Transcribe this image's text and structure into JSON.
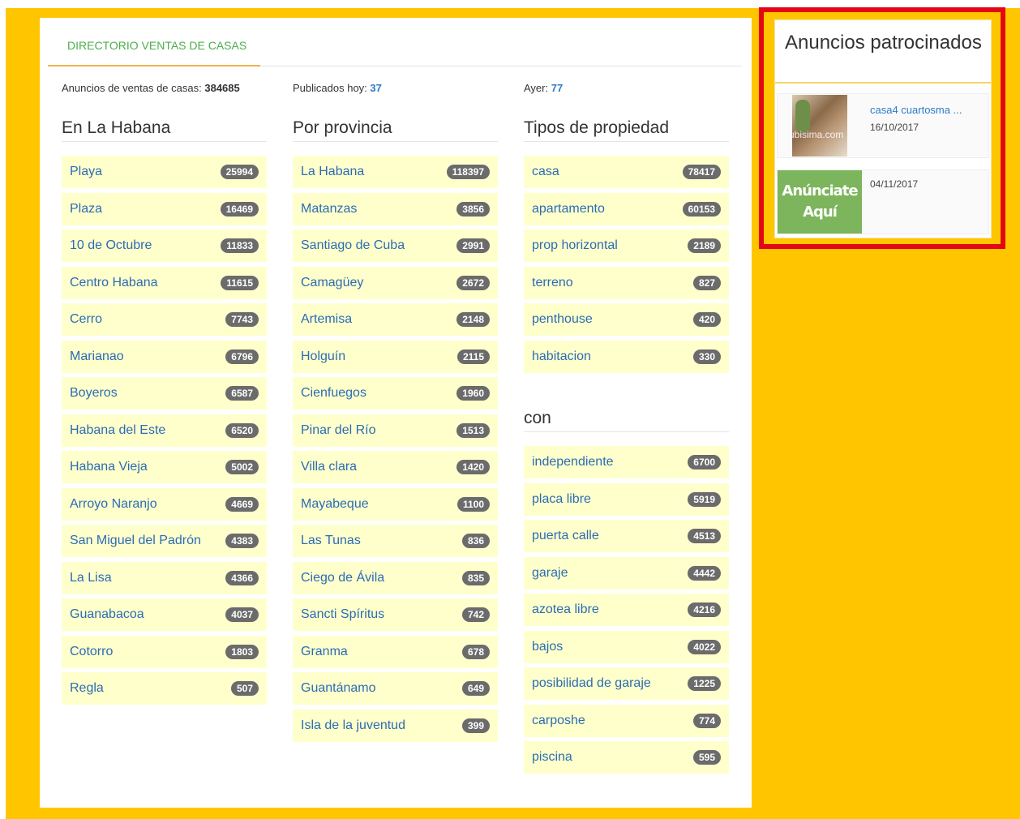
{
  "tab": {
    "label": "DIRECTORIO VENTAS DE CASAS"
  },
  "stats": {
    "total_label": "Anuncios de ventas de casas:",
    "total_value": "384685",
    "today_label": "Publicados hoy:",
    "today_value": "37",
    "yesterday_label": "Ayer:",
    "yesterday_value": "77"
  },
  "habana": {
    "title": "En La Habana",
    "items": [
      {
        "label": "Playa",
        "count": "25994"
      },
      {
        "label": "Plaza",
        "count": "16469"
      },
      {
        "label": "10 de Octubre",
        "count": "11833"
      },
      {
        "label": "Centro Habana",
        "count": "11615"
      },
      {
        "label": "Cerro",
        "count": "7743"
      },
      {
        "label": "Marianao",
        "count": "6796"
      },
      {
        "label": "Boyeros",
        "count": "6587"
      },
      {
        "label": "Habana del Este",
        "count": "6520"
      },
      {
        "label": "Habana Vieja",
        "count": "5002"
      },
      {
        "label": "Arroyo Naranjo",
        "count": "4669"
      },
      {
        "label": "San Miguel del Padrón",
        "count": "4383"
      },
      {
        "label": "La Lisa",
        "count": "4366"
      },
      {
        "label": "Guanabacoa",
        "count": "4037"
      },
      {
        "label": "Cotorro",
        "count": "1803"
      },
      {
        "label": "Regla",
        "count": "507"
      }
    ]
  },
  "provincia": {
    "title": "Por provincia",
    "items": [
      {
        "label": "La Habana",
        "count": "118397"
      },
      {
        "label": "Matanzas",
        "count": "3856"
      },
      {
        "label": "Santiago de Cuba",
        "count": "2991"
      },
      {
        "label": "Camagüey",
        "count": "2672"
      },
      {
        "label": "Artemisa",
        "count": "2148"
      },
      {
        "label": "Holguín",
        "count": "2115"
      },
      {
        "label": "Cienfuegos",
        "count": "1960"
      },
      {
        "label": "Pinar del Río",
        "count": "1513"
      },
      {
        "label": "Villa clara",
        "count": "1420"
      },
      {
        "label": "Mayabeque",
        "count": "1100"
      },
      {
        "label": "Las Tunas",
        "count": "836"
      },
      {
        "label": "Ciego de Ávila",
        "count": "835"
      },
      {
        "label": "Sancti Spíritus",
        "count": "742"
      },
      {
        "label": "Granma",
        "count": "678"
      },
      {
        "label": "Guantánamo",
        "count": "649"
      },
      {
        "label": "Isla de la juventud",
        "count": "399"
      }
    ]
  },
  "tipos": {
    "title": "Tipos de propiedad",
    "items": [
      {
        "label": "casa",
        "count": "78417"
      },
      {
        "label": "apartamento",
        "count": "60153"
      },
      {
        "label": "prop horizontal",
        "count": "2189"
      },
      {
        "label": "terreno",
        "count": "827"
      },
      {
        "label": "penthouse",
        "count": "420"
      },
      {
        "label": "habitacion",
        "count": "330"
      }
    ]
  },
  "con": {
    "title": "con",
    "items": [
      {
        "label": "independiente",
        "count": "6700"
      },
      {
        "label": "placa libre",
        "count": "5919"
      },
      {
        "label": "puerta calle",
        "count": "4513"
      },
      {
        "label": "garaje",
        "count": "4442"
      },
      {
        "label": "azotea libre",
        "count": "4216"
      },
      {
        "label": "bajos",
        "count": "4022"
      },
      {
        "label": "posibilidad de garaje",
        "count": "1225"
      },
      {
        "label": "carposhe",
        "count": "774"
      },
      {
        "label": "piscina",
        "count": "595"
      }
    ]
  },
  "sponsored": {
    "title": "Anuncios patrocinados",
    "ad1": {
      "title": "casa4 cuartosma ...",
      "date": "16/10/2017",
      "watermark": "cubisima.com"
    },
    "ad2": {
      "promo_line1": "Anúnciate",
      "promo_line2": "Aquí",
      "date": "04/11/2017"
    }
  },
  "colors": {
    "background": "#ffc600",
    "link": "#2b6cb5",
    "row_bg": "#ffffcc",
    "badge": "#6b6b6b",
    "tab_text": "#4cae4c",
    "highlight_border": "#e30613",
    "promo_bg": "#7cb55c"
  }
}
